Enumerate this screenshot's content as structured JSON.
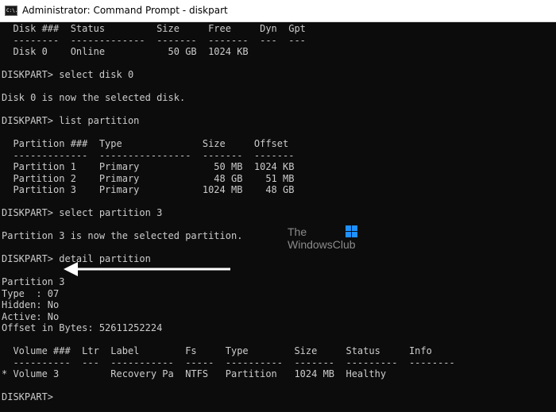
{
  "window": {
    "title": "Administrator: Command Prompt - diskpart",
    "icon": "C:\\."
  },
  "console": {
    "lines": [
      "  Disk ###  Status         Size     Free     Dyn  Gpt",
      "  --------  -------------  -------  -------  ---  ---",
      "  Disk 0    Online           50 GB  1024 KB",
      "",
      "DISKPART> select disk 0",
      "",
      "Disk 0 is now the selected disk.",
      "",
      "DISKPART> list partition",
      "",
      "  Partition ###  Type              Size     Offset",
      "  -------------  ----------------  -------  -------",
      "  Partition 1    Primary             50 MB  1024 KB",
      "  Partition 2    Primary             48 GB    51 MB",
      "  Partition 3    Primary           1024 MB    48 GB",
      "",
      "DISKPART> select partition 3",
      "",
      "Partition 3 is now the selected partition.",
      "",
      "DISKPART> detail partition",
      "",
      "Partition 3",
      "Type  : 07",
      "Hidden: No",
      "Active: No",
      "Offset in Bytes: 52611252224",
      "",
      "  Volume ###  Ltr  Label        Fs     Type        Size     Status     Info",
      "  ----------  ---  -----------  -----  ----------  -------  ---------  --------",
      "* Volume 3         Recovery Pa  NTFS   Partition   1024 MB  Healthy",
      "",
      "DISKPART>"
    ]
  },
  "watermark": {
    "line1": "The",
    "line2": "WindowsClub",
    "logo_icon": "windows-logo-icon",
    "logo_color": "#1e90ff"
  },
  "annotation": {
    "icon": "left-arrow-icon",
    "color": "#ffffff"
  },
  "colors": {
    "console_bg": "#0c0c0c",
    "console_text": "#cccccc",
    "titlebar_bg": "#ffffff"
  }
}
